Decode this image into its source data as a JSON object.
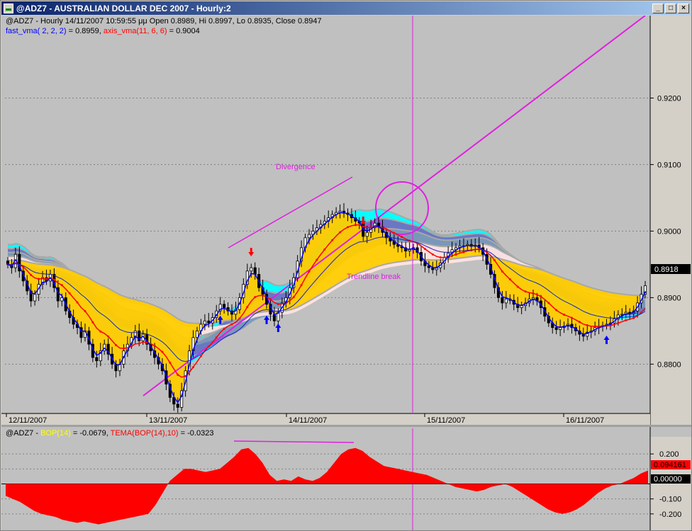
{
  "window": {
    "title": "@ADZ7 - AUSTRALIAN DOLLAR DEC 2007 - Hourly:2",
    "minimize_glyph": "_",
    "maximize_glyph": "□",
    "close_glyph": "×"
  },
  "header": {
    "line1": "@ADZ7 - Hourly 14/11/2007 10:59:55 μμ Open 0.8989, Hi 0.8997, Lo 0.8935, Close 0.8947",
    "ind1_name": "fast_vma( 2, 2, 2)",
    "ind1_value": " = 0.8959, ",
    "ind2_name": "axis_vma(11, 6, 6)",
    "ind2_value": " = 0.9004"
  },
  "lower_header": {
    "symbol": "@ADZ7 - ",
    "ind1_name": "BOP(14)",
    "ind1_value": " = -0.0679, ",
    "ind2_name": "TEMA(BOP(14),10)",
    "ind2_value": " = -0.0323"
  },
  "annotations": {
    "divergence": "Divergence",
    "trendline_break": "Trendline break"
  },
  "colors": {
    "background": "#c0c0c0",
    "fast_vma": "#0000ff",
    "axis_vma": "#ff0000",
    "bop": "#ff0000",
    "band_yellow": "#ffcc00",
    "band_pink": "#ffe4e1",
    "band_steel": "#7a9ab8",
    "band_slate": "#7070c0",
    "band_cyan": "#00ffff",
    "trendline": "#e020e0"
  },
  "chart_data": [
    {
      "type": "candlestick",
      "panel": "price",
      "title": "@ADZ7 - Hourly",
      "y_ticks": [
        "0.9200",
        "0.9100",
        "0.9000",
        "0.8900",
        "0.8800"
      ],
      "y_tick_values": [
        0.92,
        0.91,
        0.9,
        0.89,
        0.88
      ],
      "ylim": [
        0.8728,
        0.9292
      ],
      "x_labels": [
        "12/11/2007",
        "13/11/2007",
        "14/11/2007",
        "15/11/2007",
        "16/11/2007"
      ],
      "last_price_label": "0.8918",
      "last_price": 0.8918,
      "close": [
        0.895,
        0.8945,
        0.8965,
        0.894,
        0.8925,
        0.891,
        0.8895,
        0.8905,
        0.892,
        0.893,
        0.8925,
        0.8935,
        0.8915,
        0.8895,
        0.89,
        0.888,
        0.887,
        0.886,
        0.8855,
        0.884,
        0.885,
        0.883,
        0.881,
        0.8805,
        0.882,
        0.883,
        0.8815,
        0.88,
        0.879,
        0.88,
        0.882,
        0.883,
        0.884,
        0.885,
        0.8835,
        0.8845,
        0.883,
        0.882,
        0.881,
        0.88,
        0.879,
        0.877,
        0.875,
        0.874,
        0.8735,
        0.876,
        0.879,
        0.882,
        0.884,
        0.885,
        0.886,
        0.8865,
        0.8862,
        0.887,
        0.888,
        0.889,
        0.8885,
        0.888,
        0.8875,
        0.8882,
        0.89,
        0.892,
        0.894,
        0.8945,
        0.8935,
        0.8915,
        0.8905,
        0.889,
        0.8875,
        0.8865,
        0.8878,
        0.8892,
        0.89,
        0.8915,
        0.893,
        0.8955,
        0.8975,
        0.899,
        0.8995,
        0.9,
        0.9005,
        0.901,
        0.9015,
        0.902,
        0.9025,
        0.9028,
        0.903,
        0.9027,
        0.9025,
        0.902,
        0.9015,
        0.9012,
        0.8992,
        0.8998,
        0.9005,
        0.9012,
        0.9006,
        0.8998,
        0.899,
        0.8985,
        0.898,
        0.8977,
        0.8975,
        0.897,
        0.8972,
        0.8975,
        0.8968,
        0.8955,
        0.8948,
        0.8945,
        0.8942,
        0.8945,
        0.8952,
        0.896,
        0.8967,
        0.8972,
        0.8975,
        0.8978,
        0.8978,
        0.898,
        0.8977,
        0.8979,
        0.8975,
        0.8965,
        0.895,
        0.8935,
        0.8915,
        0.89,
        0.8892,
        0.8898,
        0.8896,
        0.889,
        0.8885,
        0.8888,
        0.8892,
        0.8898,
        0.89,
        0.8895,
        0.8885,
        0.8872,
        0.8862,
        0.8855,
        0.8852,
        0.8855,
        0.8857,
        0.886,
        0.8855,
        0.885,
        0.8845,
        0.8842,
        0.8848,
        0.885,
        0.8855,
        0.8857,
        0.8858,
        0.886,
        0.8862,
        0.8868,
        0.8874,
        0.8875,
        0.8878,
        0.8876,
        0.888,
        0.8892,
        0.8905,
        0.8918
      ],
      "series": [
        {
          "name": "fast_vma( 2, 2, 2)",
          "color": "#0000ff",
          "values_key": "fast_vma"
        },
        {
          "name": "axis_vma(11, 6, 6)",
          "color": "#ff0000",
          "values_key": "axis_vma"
        }
      ],
      "fast_vma_last": 0.8959,
      "axis_vma_last": 0.9004
    },
    {
      "type": "area",
      "panel": "indicator",
      "y_ticks": [
        "0.200",
        "-0.100",
        "-0.200"
      ],
      "y_tick_values": [
        0.2,
        -0.1,
        -0.2
      ],
      "zero_label": "0.00000",
      "last_value_label": "0.094161",
      "ylim": [
        -0.3,
        0.3
      ],
      "series": [
        {
          "name": "BOP(14)",
          "color": "#ffff00",
          "last": -0.0679
        },
        {
          "name": "TEMA(BOP(14),10)",
          "color": "#ff0000",
          "last": -0.0323
        }
      ],
      "values": [
        -0.08,
        -0.1,
        -0.12,
        -0.15,
        -0.18,
        -0.2,
        -0.21,
        -0.22,
        -0.24,
        -0.25,
        -0.26,
        -0.25,
        -0.26,
        -0.27,
        -0.26,
        -0.25,
        -0.24,
        -0.23,
        -0.22,
        -0.21,
        -0.2,
        -0.14,
        -0.06,
        0.02,
        0.06,
        0.1,
        0.1,
        0.09,
        0.08,
        0.09,
        0.1,
        0.14,
        0.18,
        0.23,
        0.24,
        0.2,
        0.14,
        0.06,
        0.02,
        0.03,
        0.02,
        0.05,
        0.03,
        0.02,
        0.04,
        0.08,
        0.14,
        0.2,
        0.23,
        0.24,
        0.22,
        0.18,
        0.15,
        0.12,
        0.11,
        0.1,
        0.09,
        0.08,
        0.07,
        0.06,
        0.04,
        0.02,
        0.0,
        -0.02,
        -0.03,
        -0.04,
        -0.05,
        -0.04,
        -0.02,
        -0.01,
        0.0,
        -0.02,
        -0.05,
        -0.08,
        -0.11,
        -0.14,
        -0.17,
        -0.19,
        -0.2,
        -0.19,
        -0.17,
        -0.14,
        -0.1,
        -0.06,
        -0.03,
        -0.01,
        0.0,
        0.02,
        0.04,
        0.07,
        0.09
      ]
    }
  ]
}
